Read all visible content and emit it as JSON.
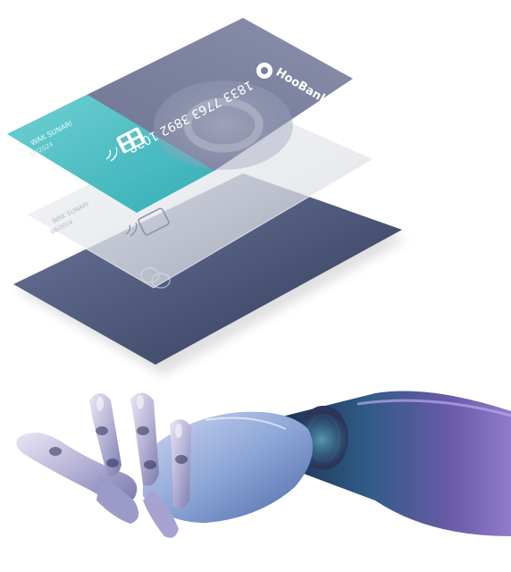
{
  "illustration": {
    "top_card": {
      "bank_name": "HooBank",
      "card_number": "1833 7763 3892 1028",
      "holder_name": "WAK SUNARI",
      "expiry": "08/2024"
    },
    "bottom_card": {
      "holder_name": "WAK SUNARI",
      "expiry": "08/2024"
    }
  }
}
